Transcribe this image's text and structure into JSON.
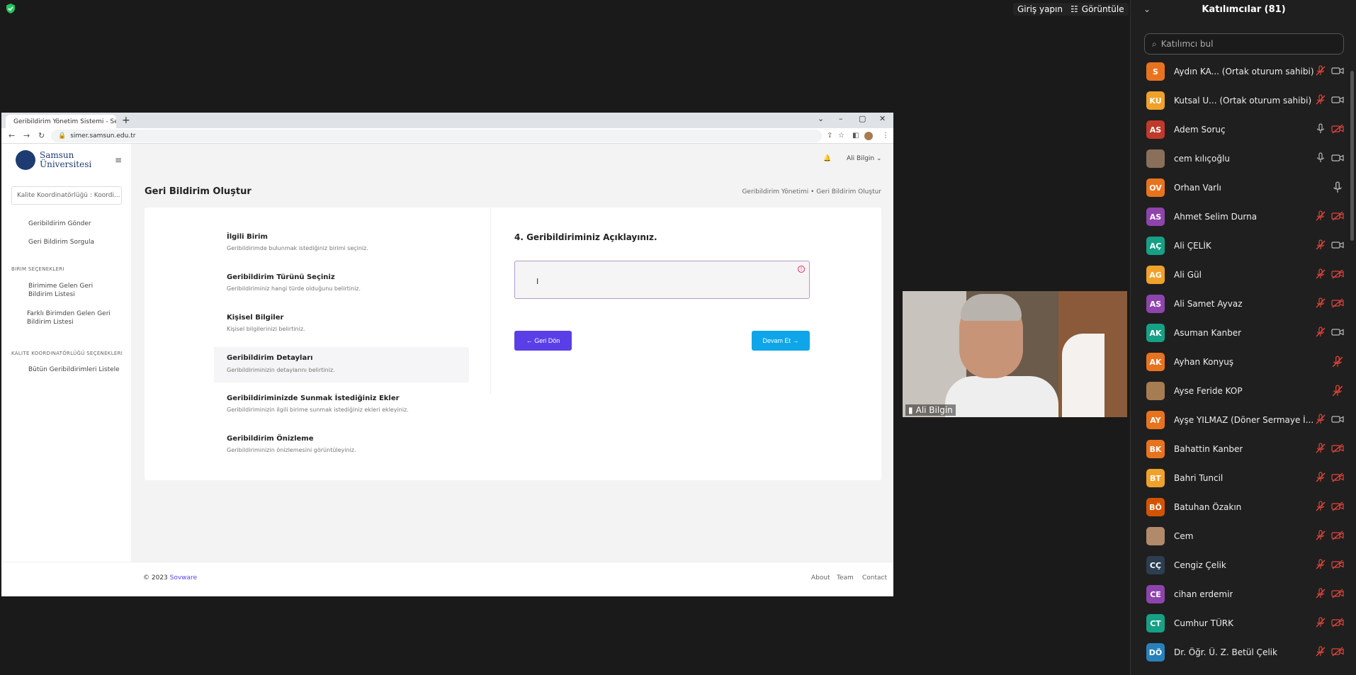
{
  "zoom_top": {
    "signin_label": "Giriş yapın",
    "view_label": "Görüntüle"
  },
  "browser": {
    "tab_title": "Geribildirim Yönetim Sistemi - Se",
    "url": "simer.samsun.edu.tr"
  },
  "app": {
    "logo_line1": "Samsun",
    "logo_line2": "Üniversitesi",
    "unit_select": "Kalite Koordinatörlüğü : Koordi...",
    "user_name": "Ali Bilgin",
    "sidebar": {
      "link_send": "Geribildirim Gönder",
      "link_query": "Geri Bildirim Sorgula",
      "head_unit": "BIRIM SEÇENEKLERI",
      "link_unit_incoming": "Birimime Gelen Geri Bildirim Listesi",
      "link_other_unit": "Farklı Birimden Gelen Geri Bildirim Listesi",
      "head_quality": "KALITE KOORDINATÖRLÜĞÜ SEÇENEKLERI",
      "link_all": "Bütün Geribildirimleri Listele"
    },
    "page_title": "Geri Bildirim Oluştur",
    "breadcrumb": "Geribildirim Yönetimi • Geri Bildirim Oluştur",
    "steps": [
      {
        "title": "İlgili Birim",
        "desc": "Geribildirimde bulunmak istediğiniz birimi seçiniz."
      },
      {
        "title": "Geribildirim Türünü Seçiniz",
        "desc": "Geribildiriminiz hangi türde olduğunu belirtiniz."
      },
      {
        "title": "Kişisel Bilgiler",
        "desc": "Kişisel bilgilerinizi belirtiniz."
      },
      {
        "title": "Geribildirim Detayları",
        "desc": "Geribildiriminizin detaylarını belirtiniz."
      },
      {
        "title": "Geribildiriminizde Sunmak İstediğiniz Ekler",
        "desc": "Geribildiriminizin ilgili birime sunmak istediğiniz ekleri ekleyiniz."
      },
      {
        "title": "Geribildirim Önizleme",
        "desc": "Geribildiriminizin önizlemesini görüntüleyiniz."
      }
    ],
    "question_title": "4. Geribildiriminiz Açıklayınız.",
    "back_label": "← Geri Dön",
    "next_label": "Devam Et →",
    "footer_copy": "© 2023",
    "footer_brand": "Sovware",
    "footer_links": [
      "About",
      "Team",
      "Contact"
    ]
  },
  "video": {
    "name": "Ali Bilgin"
  },
  "participants": {
    "title": "Katılımcılar (81)",
    "search_placeholder": "Katılımcı bul",
    "list": [
      {
        "initials": "S",
        "name": "Aydın KA...  (Ortak oturum sahibi)",
        "color": "#e8731f",
        "mic": "muted",
        "cam": "on"
      },
      {
        "initials": "KU",
        "name": "Kutsal U...  (Ortak oturum sahibi)",
        "color": "#f0a12a",
        "mic": "muted",
        "cam": "on"
      },
      {
        "initials": "AS",
        "name": "Adem Soruç",
        "color": "#c0392b",
        "mic": "on",
        "cam": "off"
      },
      {
        "initials": "",
        "name": "cem kılıçoğlu",
        "color": "#8a6f5a",
        "mic": "on",
        "cam": "on"
      },
      {
        "initials": "OV",
        "name": "Orhan Varlı",
        "color": "#e8731f",
        "mic": "on",
        "cam": "none"
      },
      {
        "initials": "AS",
        "name": "Ahmet Selim Durna",
        "color": "#8e44ad",
        "mic": "muted",
        "cam": "off"
      },
      {
        "initials": "AÇ",
        "name": "Ali ÇELİK",
        "color": "#16a085",
        "mic": "muted",
        "cam": "on"
      },
      {
        "initials": "AG",
        "name": "Ali Gül",
        "color": "#f0a12a",
        "mic": "muted",
        "cam": "off"
      },
      {
        "initials": "AS",
        "name": "Ali Samet Ayvaz",
        "color": "#8e44ad",
        "mic": "muted",
        "cam": "off"
      },
      {
        "initials": "AK",
        "name": "Asuman Kanber",
        "color": "#16a085",
        "mic": "muted",
        "cam": "on"
      },
      {
        "initials": "AK",
        "name": "Ayhan Konyuş",
        "color": "#e8731f",
        "mic": "none",
        "cam": "muted-only"
      },
      {
        "initials": "",
        "name": "Ayse Feride KOP",
        "color": "#a67c52",
        "mic": "none",
        "cam": "muted-only"
      },
      {
        "initials": "AY",
        "name": "Ayşe YILMAZ (Döner Sermaye İ...",
        "color": "#e8731f",
        "mic": "muted",
        "cam": "on"
      },
      {
        "initials": "BK",
        "name": "Bahattin Kanber",
        "color": "#e8731f",
        "mic": "muted",
        "cam": "off"
      },
      {
        "initials": "BT",
        "name": "Bahri Tuncil",
        "color": "#f0a12a",
        "mic": "muted",
        "cam": "off"
      },
      {
        "initials": "BÖ",
        "name": "Batuhan Özakın",
        "color": "#d35400",
        "mic": "muted",
        "cam": "off"
      },
      {
        "initials": "",
        "name": "Cem",
        "color": "#b08a6a",
        "mic": "muted",
        "cam": "off"
      },
      {
        "initials": "CÇ",
        "name": "Cengiz Çelik",
        "color": "#2c3e50",
        "mic": "muted",
        "cam": "off"
      },
      {
        "initials": "CE",
        "name": "cihan erdemir",
        "color": "#8e44ad",
        "mic": "muted",
        "cam": "off"
      },
      {
        "initials": "CT",
        "name": "Cumhur TÜRK",
        "color": "#16a085",
        "mic": "muted",
        "cam": "off"
      },
      {
        "initials": "DÖ",
        "name": "Dr. Öğr. Ü. Z. Betül Çelik",
        "color": "#2980b9",
        "mic": "muted",
        "cam": "off"
      }
    ]
  }
}
